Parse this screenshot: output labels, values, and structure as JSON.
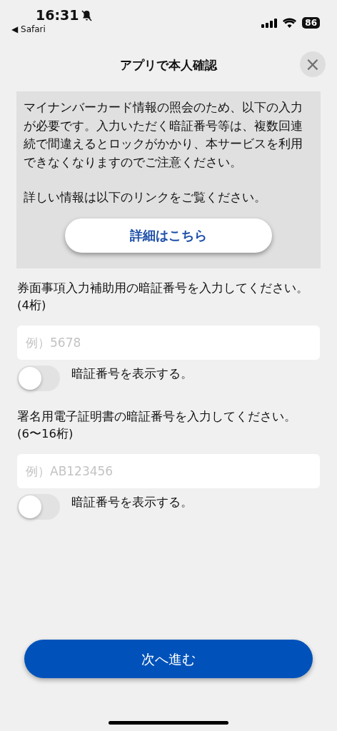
{
  "status_bar": {
    "time": "16:31",
    "back_app": "◀ Safari",
    "battery": "86"
  },
  "header": {
    "title": "アプリで本人確認",
    "close": "×"
  },
  "notice": {
    "paragraphs": [
      "マイナンバーカード情報の照会のため、以下の入力が必要です。入力いただく暗証番号等は、複数回連続で間違えるとロックがかかり、本サービスを利用できなくなりますのでご注意ください。",
      "詳しい情報は以下のリンクをご覧ください。"
    ],
    "link_button": "詳細はこちら"
  },
  "fields": [
    {
      "label": "券面事項入力補助用の暗証番号を入力してください。(4桁)",
      "placeholder": "例）5678",
      "toggle": {
        "label": "暗証番号を表示する。",
        "on": false
      }
    },
    {
      "label": "署名用電子証明書の暗証番号を入力してください。(6〜16桁)",
      "placeholder": "例）AB123456",
      "toggle": {
        "label": "暗証番号を表示する。",
        "on": false
      }
    }
  ],
  "next_button": "次へ進む"
}
